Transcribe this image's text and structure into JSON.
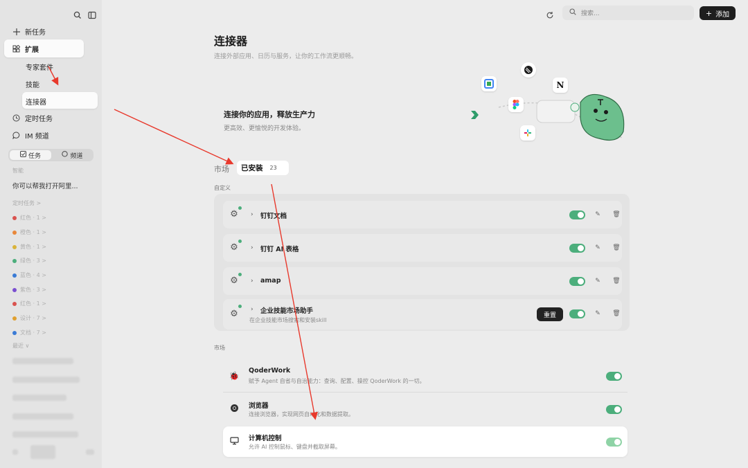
{
  "sidebar": {
    "new_task": "新任务",
    "extensions": "扩展",
    "expert_kit": "专家套件",
    "skills": "技能",
    "connectors": "连接器",
    "scheduled": "定时任务",
    "im_channel": "IM 频道",
    "seg_tasks": "任务",
    "seg_channels": "频道",
    "recent_label": "智能",
    "recent_task": "你可以帮我打开阿里...",
    "tasks_header": "定时任务 >",
    "color_tasks": [
      {
        "label": "红色 · 1 >",
        "color": "#d9534f"
      },
      {
        "label": "橙色 · 1 >",
        "color": "#e8873a"
      },
      {
        "label": "黄色 · 1 >",
        "color": "#d9b33a"
      },
      {
        "label": "绿色 · 3 >",
        "color": "#4cae7c"
      },
      {
        "label": "蓝色 · 4 >",
        "color": "#3a7bd5"
      },
      {
        "label": "紫色 · 3 >",
        "color": "#7a4fd0"
      },
      {
        "label": "红色 · 1 >",
        "color": "#d9534f"
      },
      {
        "label": "设计 · 7 >",
        "color": "#e0a030"
      },
      {
        "label": "文档 · 7 >",
        "color": "#3a7bd5"
      }
    ],
    "recent_header": "最近 ∨"
  },
  "topbar": {
    "search_placeholder": "搜索...",
    "add_label": "添加"
  },
  "page": {
    "title": "连接器",
    "subtitle": "连接外部应用、日历与服务，让你的工作流更顺畅。"
  },
  "banner": {
    "title": "连接你的应用，释放生产力",
    "subtitle": "更高效、更愉悦的开发体验。"
  },
  "tabs": {
    "market": "市场",
    "installed": "已安装",
    "installed_count": "23"
  },
  "custom": {
    "label": "自定义",
    "items": [
      {
        "name": "钉钉文档",
        "desc": ""
      },
      {
        "name": "钉钉 AI 表格",
        "desc": ""
      },
      {
        "name": "amap",
        "desc": ""
      },
      {
        "name": "企业技能市场助手",
        "desc": "在企业技能市场搜索和安装skill"
      }
    ],
    "reset_label": "重置"
  },
  "market": {
    "label": "市场",
    "items": [
      {
        "name": "QoderWork",
        "desc": "赋予 Agent 自省与自治能力：查询、配置、操控 QoderWork 的一切。",
        "icon": "bug-icon"
      },
      {
        "name": "浏览器",
        "desc": "连接浏览器，实现网页自动化和数据提取。",
        "icon": "chrome-icon"
      },
      {
        "name": "计算机控制",
        "desc": "允许 AI 控制鼠标、键盘并截取屏幕。",
        "icon": "monitor-icon"
      }
    ]
  },
  "colors": {
    "toggle_on": "#4cae7c",
    "annotation_arrow": "#e8392c"
  }
}
